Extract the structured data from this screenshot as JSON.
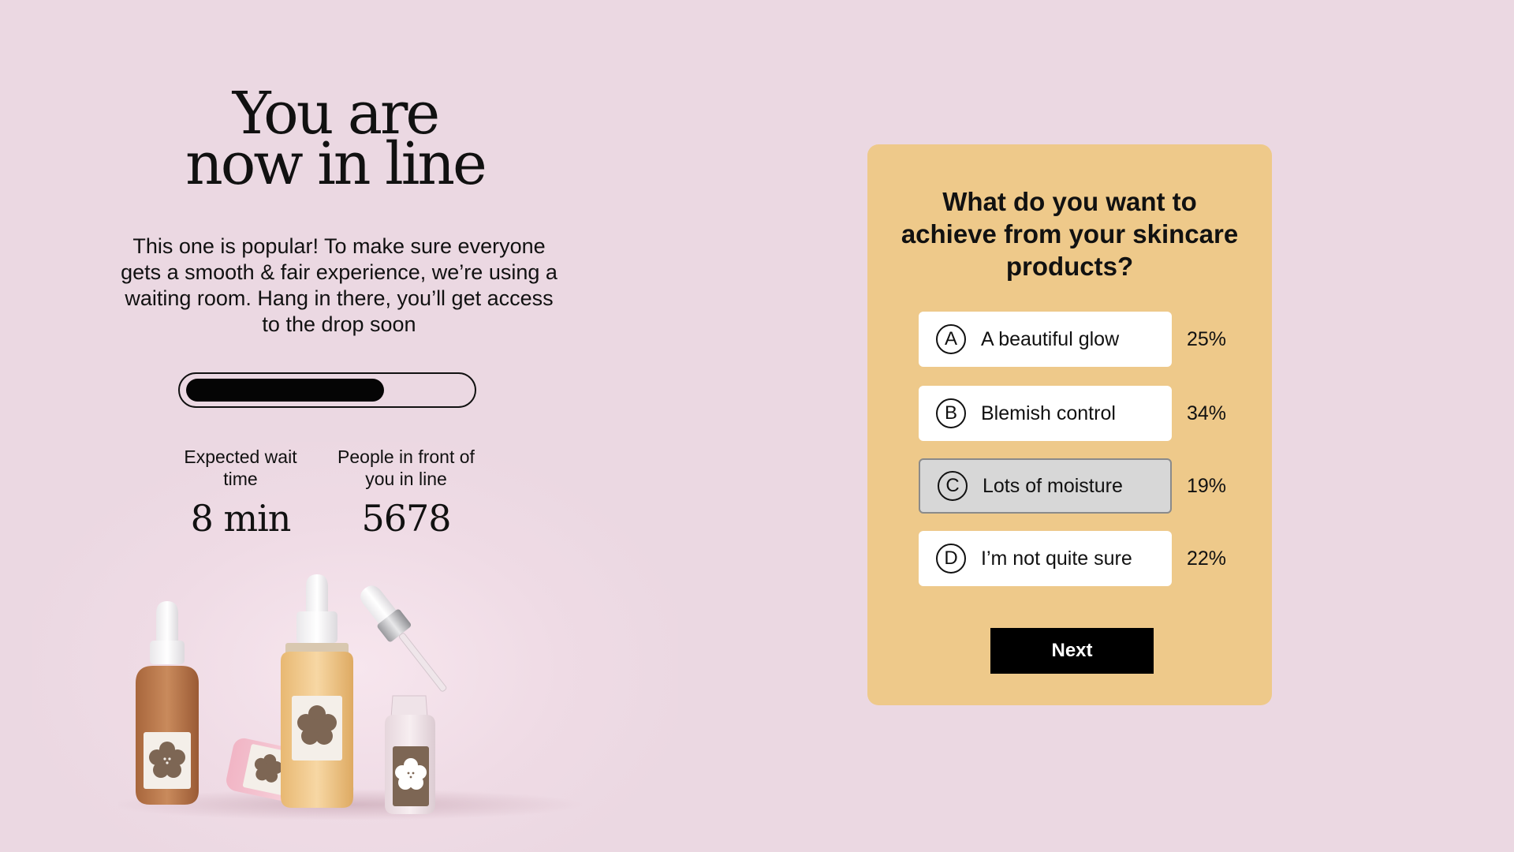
{
  "waiting_room": {
    "headline_line1": "You are",
    "headline_line2": "now in line",
    "intro_text": "This one is popular! To make sure everyone gets a smooth & fair experience, we’re using a waiting room. Hang in there, you’ll get access to the drop soon",
    "progress_fraction": 0.7,
    "wait_label": "Expected wait time",
    "wait_value": "8 min",
    "people_label": "People in front of you in line",
    "people_value": "5678"
  },
  "poll": {
    "question": "What do you want to achieve from your skincare products?",
    "options": [
      {
        "letter": "A",
        "label": "A beautiful glow",
        "percent": "25%",
        "selected": false
      },
      {
        "letter": "B",
        "label": "Blemish control",
        "percent": "34%",
        "selected": false
      },
      {
        "letter": "C",
        "label": "Lots of moisture",
        "percent": "19%",
        "selected": true
      },
      {
        "letter": "D",
        "label": "I’m not quite sure",
        "percent": "22%",
        "selected": false
      }
    ],
    "next_label": "Next"
  },
  "colors": {
    "background": "#ebd8e2",
    "card": "#eec98a",
    "button": "#000000",
    "label_brown": "#7d6654"
  },
  "icons": [
    "flower-label-icon"
  ]
}
